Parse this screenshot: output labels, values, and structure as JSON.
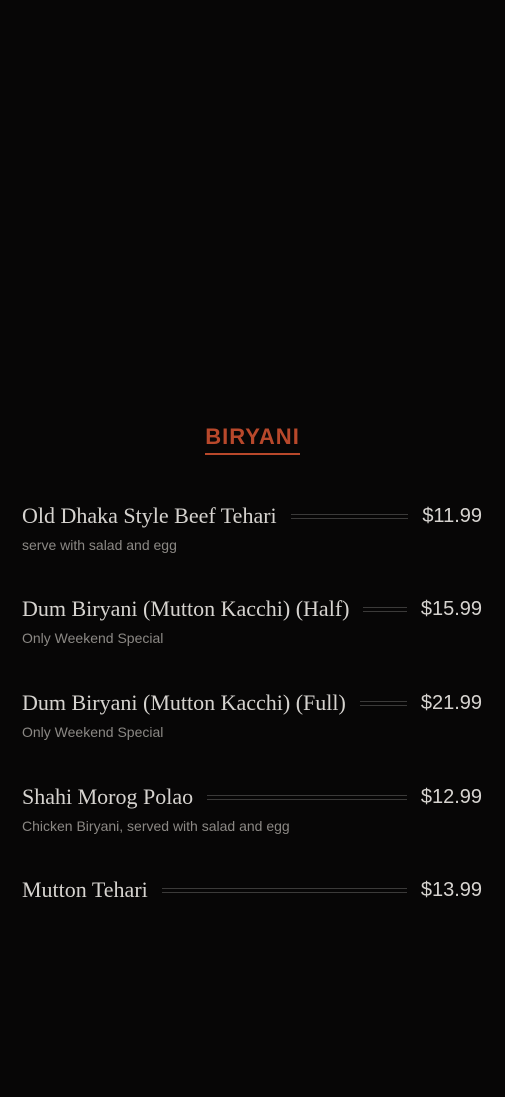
{
  "section": {
    "title": "BIRYANI",
    "accent_color": "#b8482b"
  },
  "items": [
    {
      "name": "Old Dhaka Style Beef Tehari",
      "price": "$11.99",
      "description": "serve with salad and egg"
    },
    {
      "name": "Dum Biryani (Mutton Kacchi) (Half)",
      "price": "$15.99",
      "description": "Only Weekend Special"
    },
    {
      "name": "Dum Biryani (Mutton Kacchi) (Full)",
      "price": "$21.99",
      "description": "Only Weekend Special"
    },
    {
      "name": "Shahi Morog Polao",
      "price": "$12.99",
      "description": "Chicken Biryani, served with salad and egg"
    },
    {
      "name": "Mutton Tehari",
      "price": "$13.99",
      "description": ""
    }
  ]
}
